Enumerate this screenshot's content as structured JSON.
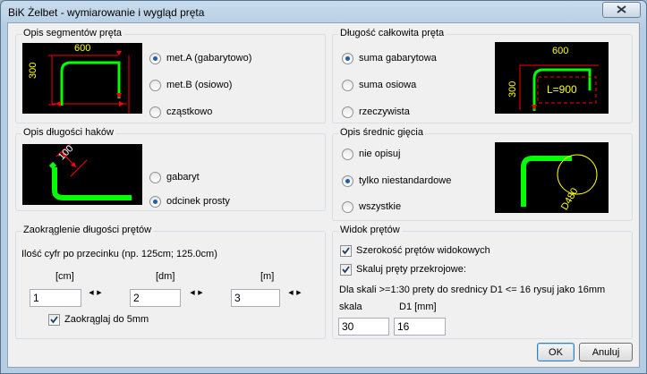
{
  "window": {
    "title": "BiK Żelbet - wymiarowanie i wygląd pręta"
  },
  "segments": {
    "title": "Opis segmentów pręta",
    "preview": {
      "top": "600",
      "left": "300"
    },
    "options": [
      "met.A (gabarytowo)",
      "met.B (osiowo)",
      "cząstkowo"
    ],
    "selected": 0
  },
  "total_length": {
    "title": "Długość całkowita pręta",
    "preview": {
      "top": "600",
      "left": "300",
      "label": "L=900"
    },
    "options": [
      "suma gabarytowa",
      "suma osiowa",
      "rzeczywista"
    ],
    "selected": 0
  },
  "hooks": {
    "title": "Opis długości haków",
    "preview": {
      "label": "100"
    },
    "options": [
      "gabaryt",
      "odcinek prosty"
    ],
    "selected": 1
  },
  "bend_diameters": {
    "title": "Opis średnic gięcia",
    "preview": {
      "label": "D480"
    },
    "options": [
      "nie opisuj",
      "tylko niestandardowe",
      "wszystkie"
    ],
    "selected": 1
  },
  "rounding": {
    "title": "Zaokrąglenie długości prętów",
    "description": "Ilość cyfr po przecinku (np. 125cm; 125.0cm)",
    "units": [
      {
        "label": "[cm]",
        "value": "1"
      },
      {
        "label": "[dm]",
        "value": "2"
      },
      {
        "label": "[m]",
        "value": "3"
      }
    ],
    "round5": {
      "label": "Zaokrąglaj do 5mm",
      "checked": true
    }
  },
  "bar_view": {
    "title": "Widok prętów",
    "visible_width": {
      "label": "Szerokość prętów widokowych",
      "checked": true
    },
    "scale_sections": {
      "label": "Skaluj pręty przekrojowe:",
      "checked": true
    },
    "rule_text": "Dla skali >=1:30 prety do srednicy D1 <= 16 rysuj jako 16mm",
    "scale_label": "skala",
    "d1_label": "D1 [mm]",
    "scale_value": "30",
    "d1_value": "16"
  },
  "buttons": {
    "ok": "OK",
    "cancel": "Anuluj"
  },
  "icons": {
    "close": "close-icon",
    "spin_left": "arrow-left-icon",
    "spin_right": "arrow-right-icon"
  },
  "colors": {
    "bar": "#00ff00",
    "dimension": "#ff0000",
    "cad_text": "#ffff00",
    "cad_background": "#000000"
  }
}
